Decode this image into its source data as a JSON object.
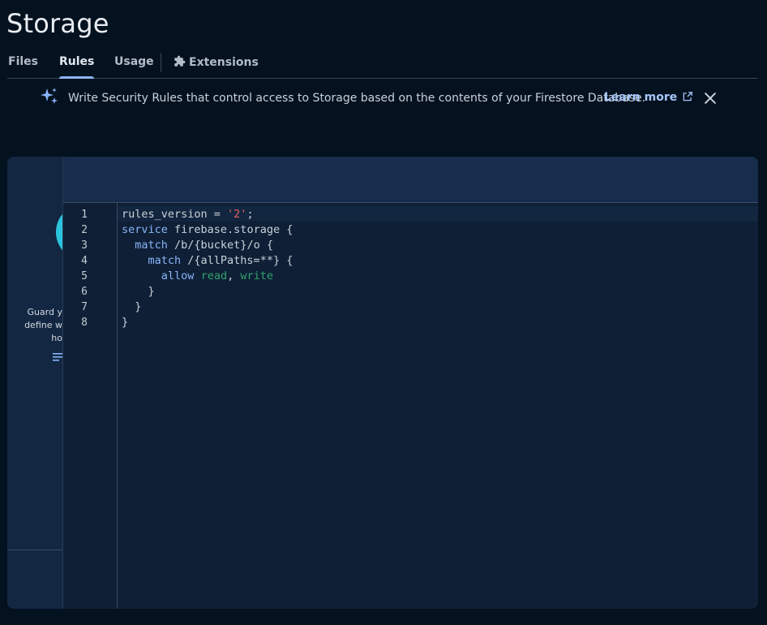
{
  "page": {
    "title": "Storage"
  },
  "tabs": [
    {
      "label": "Files"
    },
    {
      "label": "Rules"
    },
    {
      "label": "Usage"
    },
    {
      "label": "Extensions"
    }
  ],
  "banner": {
    "text": "Write Security Rules that control access to Storage based on the contents of your Firestore Database.",
    "link": "Learn more"
  },
  "side_panel": {
    "text_lines": [
      "Guard y",
      "define w",
      "ho"
    ]
  },
  "editor": {
    "line_numbers": [
      "1",
      "2",
      "3",
      "4",
      "5",
      "6",
      "7",
      "8"
    ],
    "lines": [
      "rules_version = '2';",
      "service firebase.storage {",
      "  match /b/{bucket}/o {",
      "    match /{allPaths=**} {",
      "      allow read, write",
      "    }",
      "  }",
      "}"
    ]
  },
  "colors": {
    "background": "#04111f",
    "accent": "#8ab4f8",
    "keyword": "#8ab4f8",
    "string": "#e06060",
    "identifier": "#2fa36b"
  }
}
